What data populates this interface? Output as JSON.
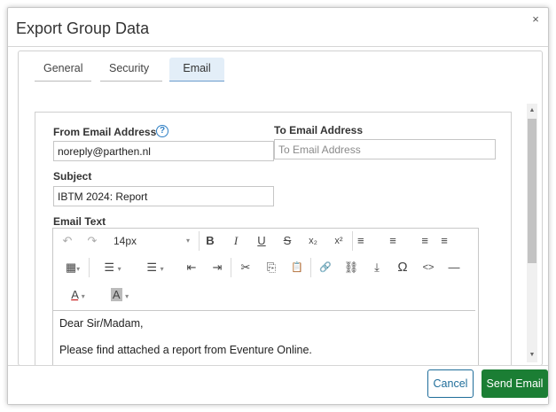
{
  "dialog": {
    "title": "Export Group Data",
    "close_icon": "×"
  },
  "tabs": [
    {
      "label": "General",
      "active": false
    },
    {
      "label": "Security",
      "active": false
    },
    {
      "label": "Email",
      "active": true
    }
  ],
  "form": {
    "from_label": "From Email Address",
    "from_value": "noreply@parthen.nl",
    "help_icon": "?",
    "to_label": "To Email Address",
    "to_placeholder": "To Email Address",
    "to_value": "",
    "subject_label": "Subject",
    "subject_value": "IBTM 2024: Report",
    "email_text_label": "Email Text"
  },
  "editor": {
    "font_size": "14px",
    "icons": {
      "undo": "↶",
      "redo": "↷",
      "bold": "B",
      "italic": "I",
      "underline": "U",
      "strike": "S",
      "subscript": "x₂",
      "superscript": "x²",
      "align_left": "≡",
      "align_center": "≡",
      "align_right": "≡",
      "justify": "≡",
      "table": "▦",
      "bullets": "☰",
      "numbers": "☰",
      "outdent": "⇤",
      "indent": "⇥",
      "cut": "✂",
      "copy": "⎘",
      "paste": "📋",
      "link": "🔗",
      "unlink": "⛓",
      "upload": "⤓",
      "omega": "Ω",
      "code": "<>",
      "hr": "—",
      "text_color": "A",
      "highlight": "A",
      "caret": "▾"
    },
    "body_lines": [
      "Dear Sir/Madam,",
      "Please find attached a report from Eventure Online."
    ]
  },
  "footer": {
    "cancel_label": "Cancel",
    "send_label": "Send Email"
  },
  "colors": {
    "accent_blue": "#1f6d9a",
    "send_green": "#1b7e34"
  }
}
